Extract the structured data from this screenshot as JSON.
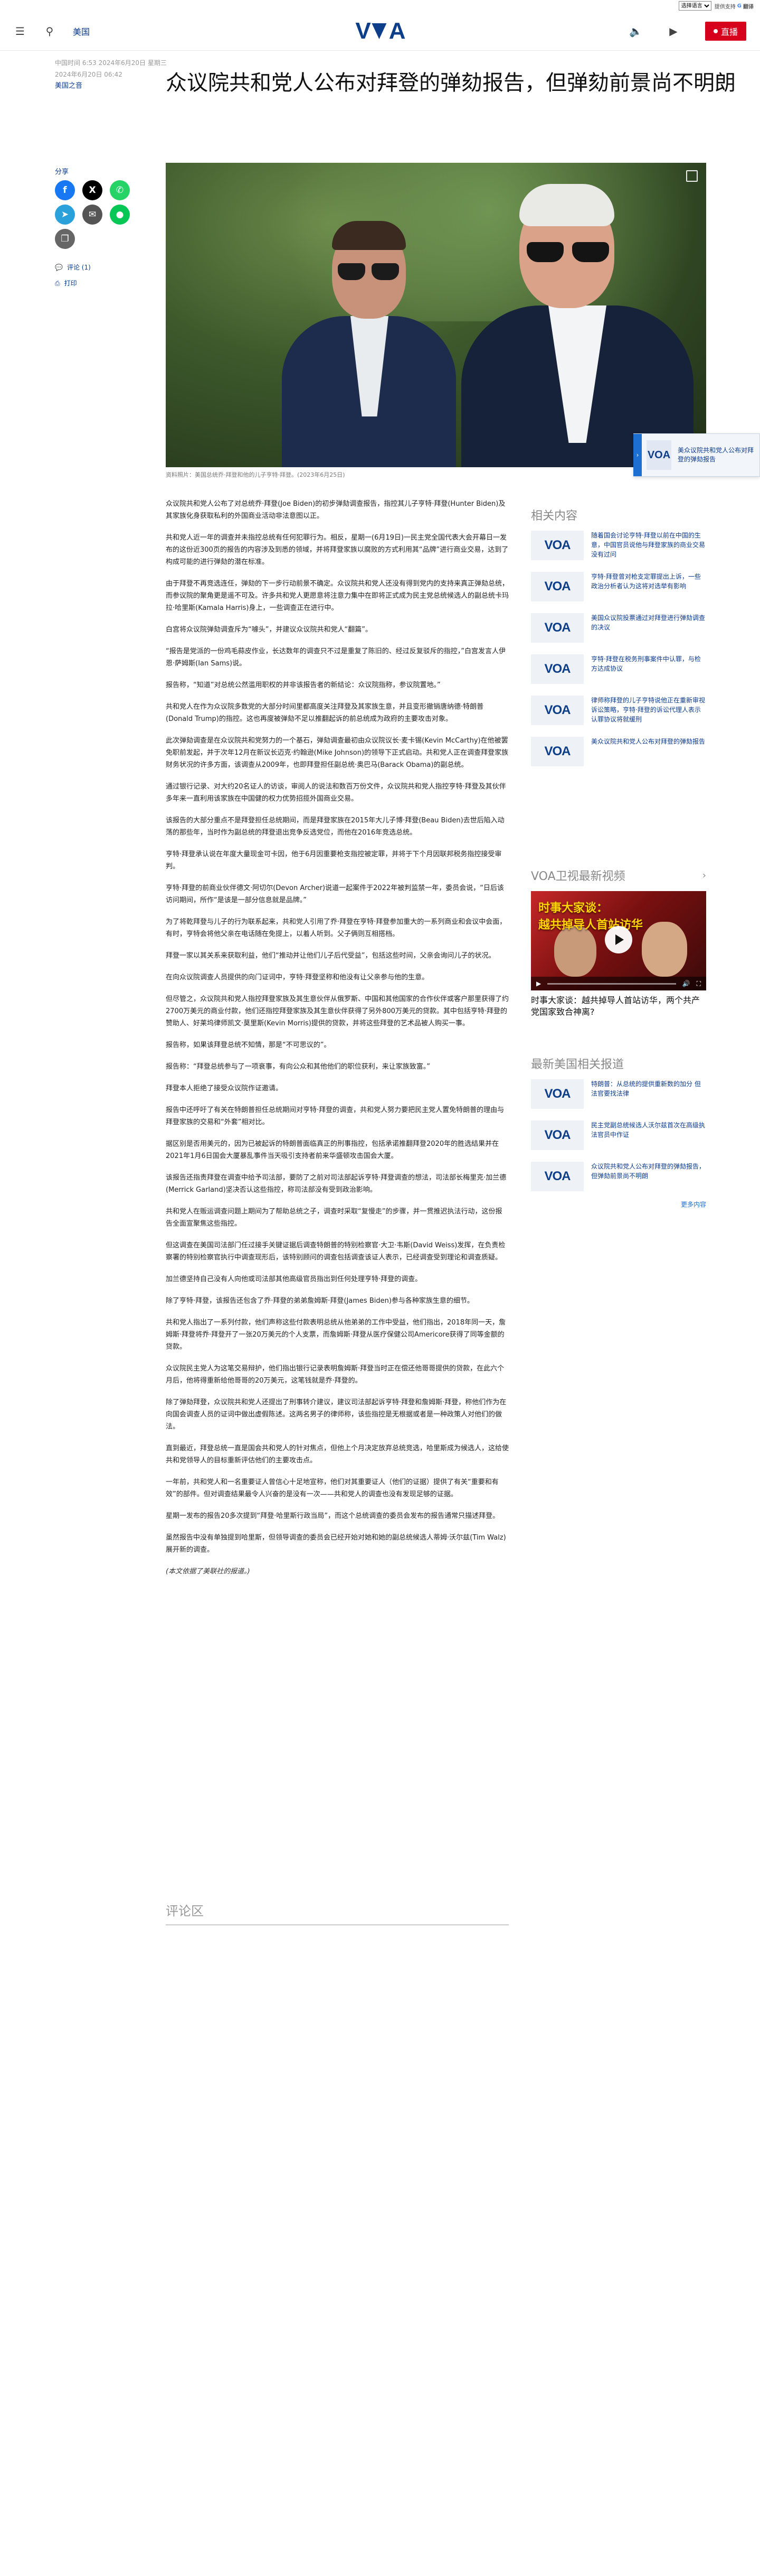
{
  "langbar": {
    "select_value": "选择语言",
    "powered": "提供支持",
    "google": "G",
    "translate": "翻译"
  },
  "header": {
    "section": "美国",
    "logo": "VOA",
    "live_label": "直播"
  },
  "article": {
    "date": "中国时间 6:53 2024年6月20日 星期三",
    "date2": "2024年6月20日 06:42",
    "author": "美国之音",
    "title": "众议院共和党人公布对拜登的弹劾报告，但弹劾前景尚不明朗",
    "share_label": "分享",
    "comments_link": "评论 (1)",
    "print_link": "打印",
    "caption": "资料照片：美国总统乔·拜登和他的儿子亨特·拜登。(2023年6月25日)",
    "paragraphs": [
      "众议院共和党人公布了对总统乔·拜登(Joe Biden)的初步弹劾调查报告，指控其儿子亨特·拜登(Hunter Biden)及其家族化身获取私利的外国商业活动非法意图以正。",
      "共和党人近一年的调查并未指控总统有任何犯罪行为。相反，星期一(6月19日)一民主党全国代表大会开幕日一发布的这份近300页的报告的内容涉及到悉的领域，并将拜登家族以腐败的方式利用其“品牌”进行商业交易，达到了构成可能的进行弹劾的潜在标准。",
      "由于拜登不再竞选连任，弹劾的下一步行动前景不确定。众议院共和党人还没有得到党内的支持来真正弹劾总统，而参议院的聚角更是遥不可及。许多共和党人更愿意将注意力集中在即将正式成为民主党总统候选人的副总统卡玛拉·哈里斯(Kamala Harris)身上，一些调查正在进行中。",
      "白宫将众议院弹劾调查斥为“噱头”，并建议众议院共和党人“翻篇”。",
      "“报告是党派的一份鸡毛蒜皮作业，长达数年的调查只不过是重复了陈旧的、经过反复驳斥的指控，”白宫发言人伊恩·萨姆斯(Ian Sams)说。",
      "报告称，“知道”对总统公然滥用职权的并非该报告者的新结论：众议院指称，参议院置地。”",
      "共和党人在作为众议院多数党的大部分时间里都高度关注拜登及其家族生意，并且变形撤销唐纳德·特朗普(Donald Trump)的指控。这也再度被弹劾不足以推翻起诉的前总统成为政府的主要攻击对象。",
      "此次弹劾调查是在众议院共和党努力的一个基石，弹劾调查最初由众议院议长·麦卡锡(Kevin McCarthy)在他被罢免职前发起，并于次年12月在新议长迈克·约翰逊(Mike Johnson)的领导下正式启动。共和党人正在调查拜登家族财务状况的许多方面，该调查从2009年，也即拜登担任副总统·奥巴马(Barack Obama)的副总统。",
      "通过银行记录、对大约20名证人的访谈，审阅人的说法和数百万份文件，众议院共和党人指控亨特·拜登及其伙伴多年来一直利用该家族在中国健的权力优势招揽外国商业交易。",
      "该报告的大部分重点不是拜登担任总统期间，而是拜登家族在2015年大儿子博·拜登(Beau Biden)去世后陷入动荡的那些年，当时作为副总统的拜登退出竞争反选党位，而他在2016年竞选总统。",
      "亨特·拜登承认说在年度大量现金可卡因，他于6月因重要枪支指控被定罪，并将于下个月因联邦税务指控接受审判。",
      "亨特·拜登的前商业伙伴德文·阿切尔(Devon Archer)说道一起案件于2022年被判监禁一年，委员会说，“日后该访问期间，所作“是该是一部分信息就是品牌。”",
      "为了将乾拜登与儿子的行为联系起来，共和党人引用了乔·拜登在亨特·拜登参加重大的一系列商业和会议中会面，有时，亨特会将他父亲在电话随在免提上，以着人听到。父子俩则互相搭档。",
      "拜登一家以其关系来获取利益，他们“推动并让他们儿子后代受益”，包括这些时间，父亲会询问儿子的状况。",
      "在向众议院调查人员提供的向门证词中，亨特·拜登坚称和他没有让父亲参与他的生意。",
      "但尽管之，众议院共和党人指控拜登家族及其生意伙伴从俄罗斯、中国和其他国家的合作伙伴或客户那里获得了约2700万美元的商业付款，他们还指控拜登家族及其生意伙伴获得了另外800万美元的贷款。其中包括亨特·拜登的赞助人、好莱坞律师凯文·莫里斯(Kevin Morris)提供的贷款，并将这些拜登的艺术品被人购买一事。",
      "报告称，如果该拜登总统不知情，那是“不可思议的”。",
      "报告称：“拜登总统参与了一项衰事，有向公众和其他他们的职位获利，来让家族致富。”",
      "拜登本人拒绝了接受众议院作证邀请。",
      "报告中还呼吁了有关在特朗普担任总统期间对亨特·拜登的调查，共和党人努力要把民主党人置免特朗普的理由与拜登家族的交易和“外套”相对比。",
      "据区别是否用美元的，因为已被起诉的特朗普面临真正的刑事指控，包括承诺推翻拜登2020年的胜选结果并在2021年1月6日国会大厦暴乱事件当天吸引支持者前来华盛顿攻击国会大厦。",
      "该报告还指责拜登在调查中给予司法部，要防了之前对司法部起诉亨特·拜登调查的想法，司法部长梅里克·加兰德(Merrick Garland)坚决否认这些指控，称司法部没有受到政治影响。",
      "共和党人在贩运调查问题上期间为了帮助总统之子，调查时采取“复慢走”的步骤，并一贯推迟执法行动，这份报告全面宣聚焦这些指控。",
      "但这调查在美国司法部门任过接手关键证据后调查特朗普的特别检察官·大卫·韦斯(David Weiss)发挥，在负责检察署的特别检察官执行中调查现形后，该特别顾问的调查包括调查该证人表示，已经调查受到理论和调查质疑。",
      "加兰德坚持自己没有人向他或司法部其他高级官员指出到任何处理亨特·拜登的调查。",
      "除了亨特·拜登，该报告还包含了乔·拜登的弟弟詹姆斯·拜登(James Biden)参与各种家族生意的细节。",
      "共和党人指出了一系列付款，他们声称这些付款表明总统从他弟弟的工作中受益，他们指出，2018年同一天，詹姆斯·拜登将乔·拜登开了一张20万美元的个人支票，而詹姆斯·拜登从医疗保健公司Americore获得了同等金额的贷款。",
      "众议院民主党人为这笔交易辩护，他们指出银行记录表明詹姆斯·拜登当时正在偿还他哥哥提供的贷款，在此六个月后，他将得重新给他哥哥的20万美元，这笔钱就是乔·拜登的。",
      "除了弹劾拜登，众议院共和党人还提出了刑事转介建议，建议司法部起诉亨特·拜登和詹姆斯·拜登，称他们作为在向国会调查人员的证词中做出虚假陈述。这两名男子的律师称，该些指控是无根据或者是一种政策人对他们的做法。",
      "直到最近，拜登总统一直是国会共和党人的针对焦点，但他上个月决定放弃总统竞选，哈里斯成为候选人，这给使共和党领导人的目标重新评估他们的主要攻击点。",
      "一年前，共和党人和一名重要证人曾信心十足地宣称，他们对其重要证人（他们的证据）提供了有关“重要和有效”的部件。但对调查结果最令人兴奋的是没有一次——共和党人的调查也没有发现足够的证据。",
      "星期一发布的报告20多次提到“拜登·哈里斯行政当局”，而这个总统调查的委员会发布的报告通常只描述拜登。",
      "虽然报告中没有单独提到哈里斯，但领导调查的委员会已经开始对她和她的副总统候选人蒂姆·沃尔兹(Tim Walz)展开新的调查。",
      "(本文依据了美联社的报道。)"
    ]
  },
  "comments_title": "评论区",
  "related": {
    "title": "相关内容",
    "items": [
      "随着国会讨论亨特·拜登以前在中国的生意，中国官员说他与拜登家族的商业交易没有过问",
      "亨特·拜登曾对枪支定罪提出上诉，一些政治分析者认为这将对选举有影响",
      "美国众议院投票通过对拜登进行弹劾调查的决议",
      "亨特·拜登在税务刑事案件中认罪，与检方达成协议",
      "律师称拜登的儿子亨特说他正在重新审视诉讼策略，亨特·拜登的诉讼代理人表示认罪协议将就缓刑",
      "美众议院共和党人公布对拜登的弹劾报告"
    ]
  },
  "voa_tv": {
    "title": "VOA卫视最新视频",
    "video_title_a": "时事大家谈：",
    "video_title_b": "越共掉导人首站访华",
    "caption": "时事大家谈：越共掉导人首站访华，两个共产党国家致合神离?"
  },
  "latest": {
    "title": "最新美国相关报道",
    "items": [
      "特朗普：从总统的提供重新数的加分 但法官要找法律",
      "民主党副总统候选人沃尔兹首次在高级执法官员中作证",
      "众议院共和党人公布对拜登的弹劾报告，但弹劾前景尚不明朗"
    ],
    "more": "更多内容"
  }
}
